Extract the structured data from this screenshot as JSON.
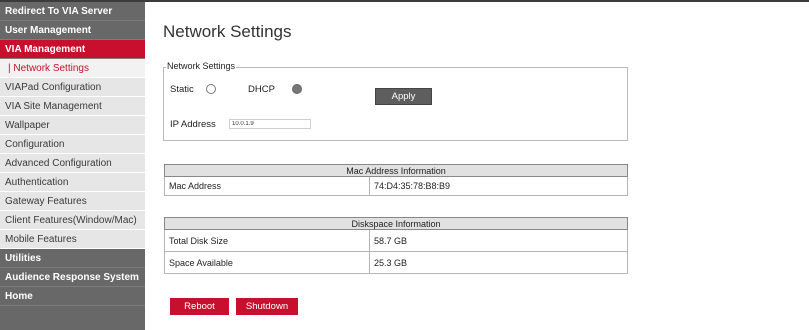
{
  "sidebar": {
    "items": [
      {
        "label": "Redirect To VIA Server"
      },
      {
        "label": "User Management"
      },
      {
        "label": "VIA Management"
      },
      {
        "label": "| Network Settings"
      },
      {
        "label": "VIAPad Configuration"
      },
      {
        "label": "VIA Site Management"
      },
      {
        "label": "Wallpaper"
      },
      {
        "label": "Configuration"
      },
      {
        "label": "Advanced Configuration"
      },
      {
        "label": "Authentication"
      },
      {
        "label": "Gateway Features"
      },
      {
        "label": "Client Features(Window/Mac)"
      },
      {
        "label": "Mobile Features"
      },
      {
        "label": "Utilities"
      },
      {
        "label": "Audience Response System"
      },
      {
        "label": "Home"
      }
    ]
  },
  "page": {
    "title": "Network Settings"
  },
  "network_settings": {
    "legend": "Network Settings",
    "static_label": "Static",
    "dhcp_label": "DHCP",
    "selected_mode": "DHCP",
    "apply_label": "Apply",
    "ip_label": "IP Address",
    "ip_value": "10.0.1.9"
  },
  "mac_table": {
    "header": "Mac Address Information",
    "rows": [
      {
        "label": "Mac Address",
        "value": "74:D4:35:78:B8:B9"
      }
    ]
  },
  "disk_table": {
    "header": "Diskspace Information",
    "rows": [
      {
        "label": "Total Disk Size",
        "value": "58.7 GB"
      },
      {
        "label": "Space Available",
        "value": "25.3 GB"
      }
    ]
  },
  "actions": {
    "reboot_label": "Reboot",
    "shutdown_label": "Shutdown"
  },
  "colors": {
    "accent": "#c8102e",
    "sidebar_group": "#686868",
    "sidebar_sub": "#e6e6e6"
  }
}
